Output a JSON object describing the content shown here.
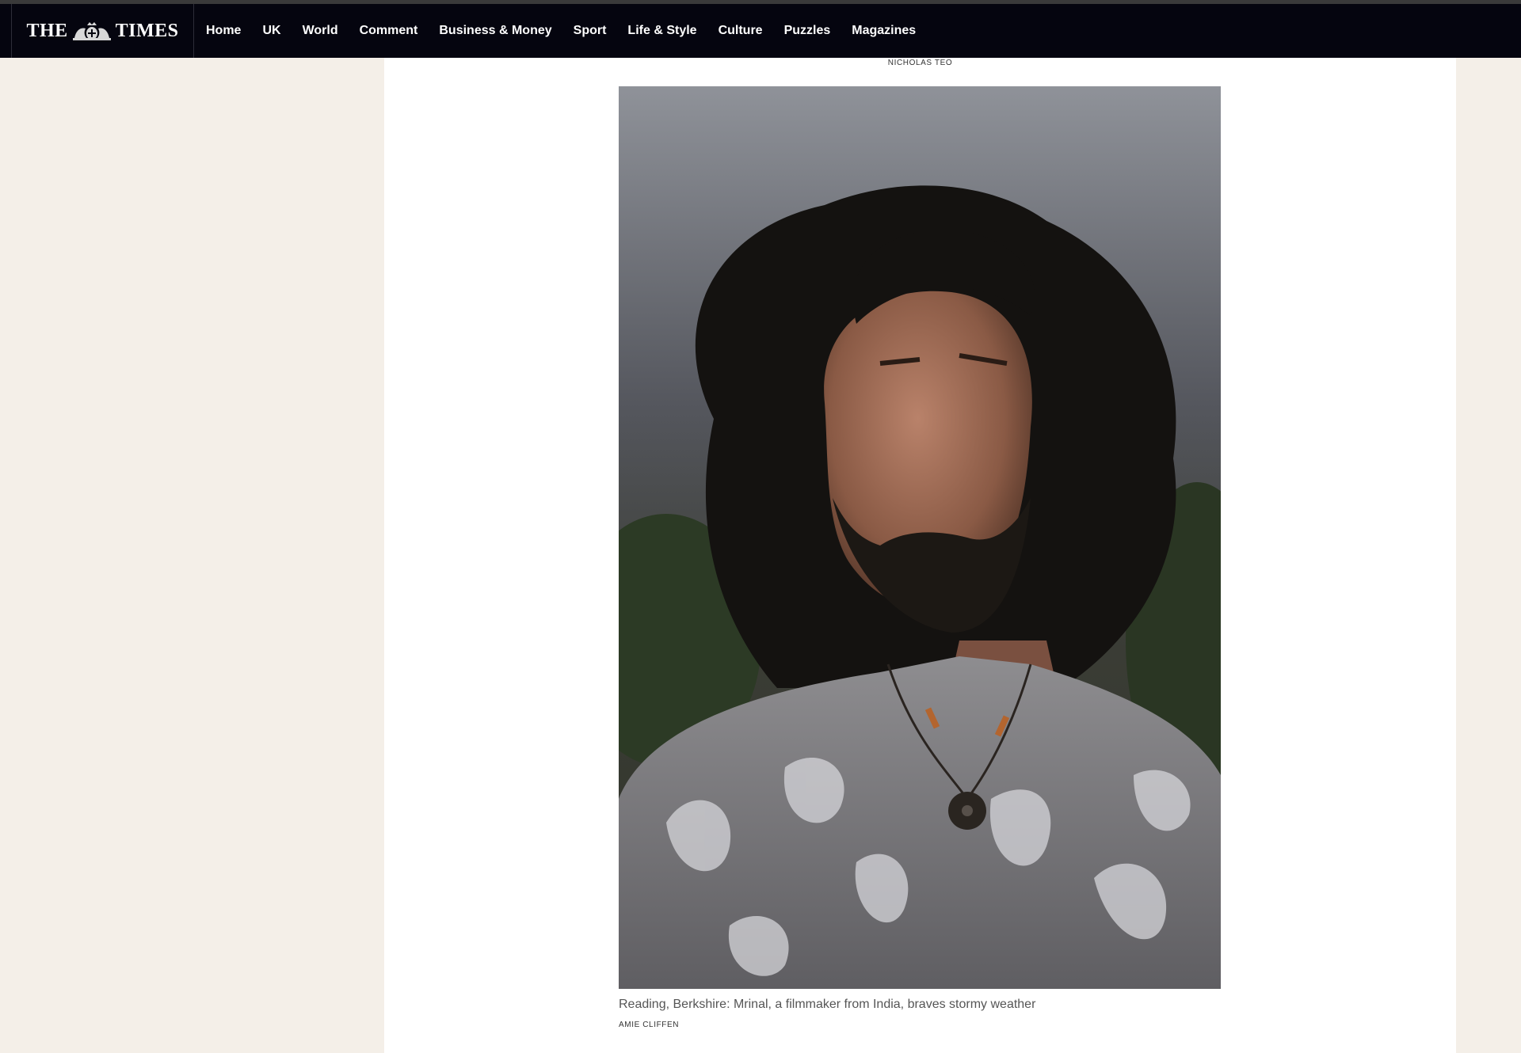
{
  "masthead": {
    "word_left": "THE",
    "word_right": "TIMES"
  },
  "nav": {
    "items": [
      {
        "label": "Home"
      },
      {
        "label": "UK"
      },
      {
        "label": "World"
      },
      {
        "label": "Comment"
      },
      {
        "label": "Business & Money"
      },
      {
        "label": "Sport"
      },
      {
        "label": "Life & Style"
      },
      {
        "label": "Culture"
      },
      {
        "label": "Puzzles"
      },
      {
        "label": "Magazines"
      }
    ]
  },
  "article": {
    "previous_photo_credit": "NICHOLAS TEO",
    "photo": {
      "caption": "Reading, Berkshire: Mrinal, a filmmaker from India, braves stormy weather",
      "credit": "AMIE CLIFFEN"
    }
  },
  "colors": {
    "nav_background": "#05050f",
    "page_background": "#f4efe8",
    "article_background": "#ffffff",
    "caption_text": "#555555"
  },
  "icons": {
    "masthead_crest": "royal-crest-icon"
  }
}
